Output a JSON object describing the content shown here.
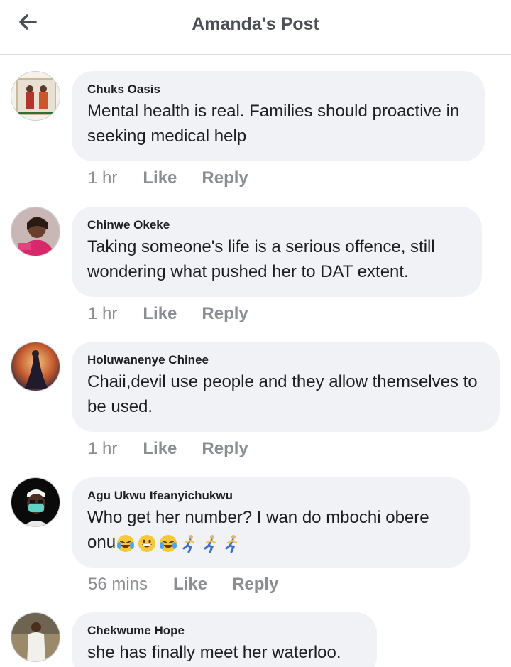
{
  "header": {
    "title": "Amanda's Post"
  },
  "actions": {
    "like": "Like",
    "reply": "Reply"
  },
  "comments": [
    {
      "author": "Chuks Oasis",
      "text": "Mental health is real. Families should proactive in seeking medical help",
      "time": "1 hr"
    },
    {
      "author": "Chinwe Okeke",
      "text": "Taking someone's life is a serious offence, still wondering what pushed her to DAT extent.",
      "time": "1 hr"
    },
    {
      "author": "Holuwanenye Chinee",
      "text": "Chaii,devil use people and they allow themselves to be used.",
      "time": "1 hr"
    },
    {
      "author": "Agu Ukwu Ifeanyichukwu",
      "text": "Who get her number? I wan do mbochi obere onu",
      "time": "56 mins",
      "emojis": [
        "crying-laughing-emoji",
        "grinning-emoji",
        "crying-laughing-emoji",
        "running-man-emoji",
        "running-man-emoji",
        "running-man-emoji"
      ]
    },
    {
      "author": "Chekwume Hope",
      "text": "she has finally meet her waterloo.",
      "time": ""
    }
  ]
}
